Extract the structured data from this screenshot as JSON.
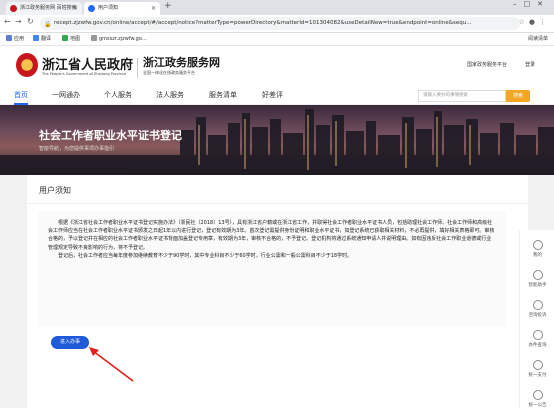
{
  "browser": {
    "tabs": [
      {
        "label": "浙江政务服务网 百姓搜索",
        "favicon_color": "#c8161d"
      },
      {
        "label": "用户须知",
        "favicon_color": "#2468f2"
      }
    ],
    "new_tab": "+",
    "url": "recept.zjzwfw.gov.cn/online/accept/#/accept/notice?matterType=powerDirectory&matterId=101304082&useDetailNew=true&endpoint=online&sequ...",
    "bookmarks": [
      {
        "label": "应用",
        "color": "#5b7bd5"
      },
      {
        "label": "翻译",
        "color": "#4285f4"
      },
      {
        "label": "地图",
        "color": "#34a853"
      },
      {
        "label": "gmsszr.zjzwfw.go...",
        "color": "#999999"
      }
    ],
    "reading_list": "阅读清单"
  },
  "header": {
    "gov_name": "浙江省人民政府",
    "gov_name_en": "The People's Government of Zhejiang Province",
    "service_name": "浙江政务服务网",
    "service_sub": "全国一体化在线政务服务平台",
    "region": "国家政务服务平台",
    "login": "登录"
  },
  "nav": {
    "items": [
      "首页",
      "一网通办",
      "个人服务",
      "法人服务",
      "服务清单",
      "好差评"
    ],
    "search_placeholder": "请输入要办的事情搜索",
    "search_button": "搜索"
  },
  "banner": {
    "title": "社会工作者职业水平证书登记",
    "subtitle": "智能导航，为您提供事项办事指引"
  },
  "main": {
    "section_title": "用户须知",
    "paragraphs": [
      "根据《浙江省社会工作者职业水平证书登记实施办法》（浙民社〔2018〕13号），具有浙江省户籍或在浙江省工作，并取得社会工作者职业水平证书人员，包括助理社会工作师、社会工作师和高级社会工作师应当在社会工作者职业水平证书颁发之日起1年以内进行登记，登记有效期为3年。首次登记需提供身份证明和职业水平证书，如登记系统已获取相关材料，不必再提供，填好相关表格即可。审核合格的，予以登记并在相应的社会工作者职业水平证书背面加盖登记专用章，有效期为3年，审核不合格的，不予登记。登记机构将通过系统通知申请人并说明理由。如有因违反社会工作职业道德或行业管理规定导致不良影响的行为，将不予登记。",
      "登记后，社会工作者应当每年度参加继续教育不少于90学时，其中专业科目不少于60学时，行业公需和一般公需科目不少于18学时。"
    ],
    "enter_button": "进入办事"
  },
  "sidebar": {
    "items": [
      "我的",
      "智能助手",
      "咨询投诉",
      "办件查询",
      "统一支付",
      "统一公告"
    ]
  }
}
